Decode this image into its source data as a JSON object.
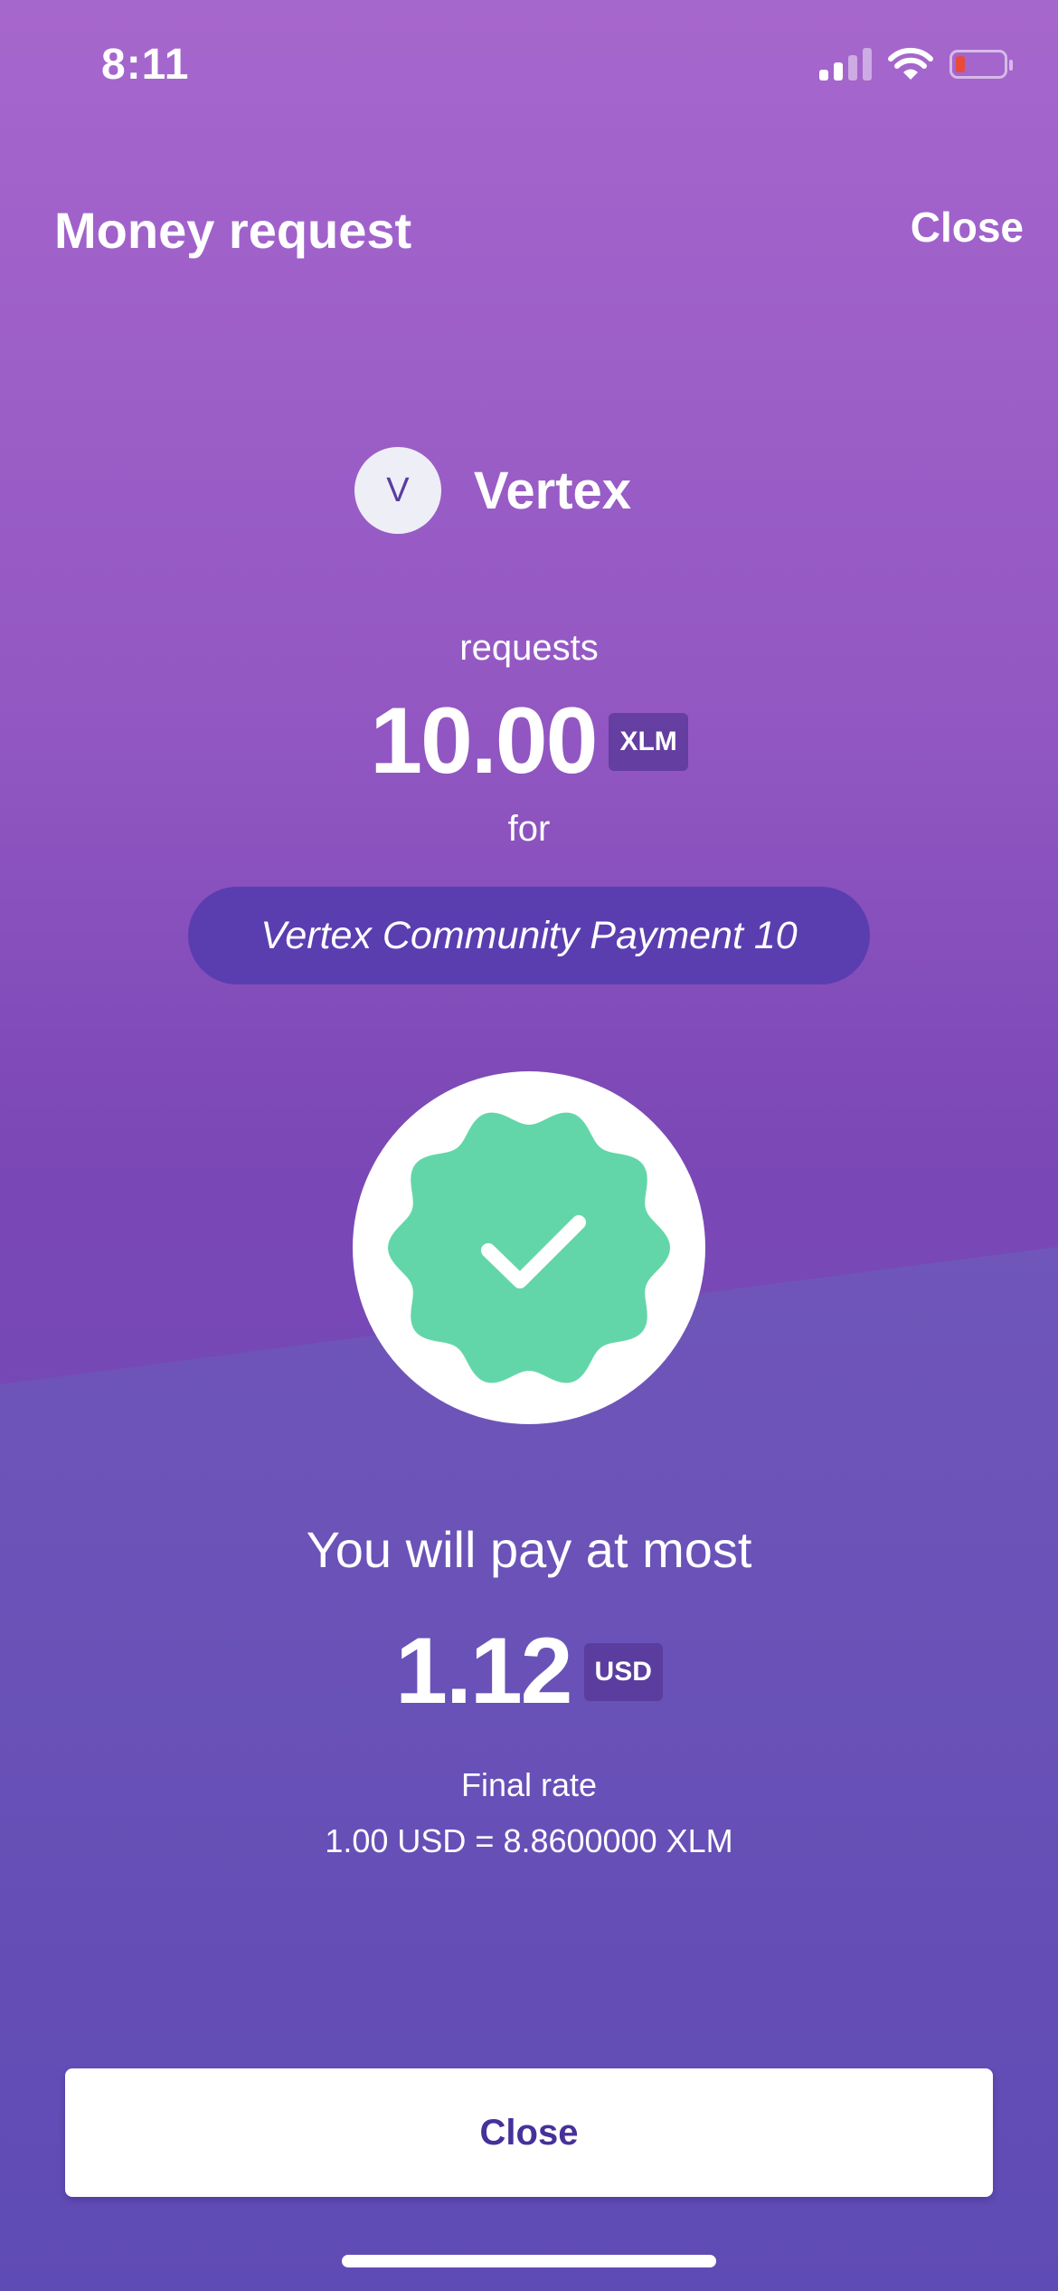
{
  "status_bar": {
    "time": "8:11",
    "signal_bars_active": 2,
    "signal_bars_total": 4,
    "battery_level_percent": 10,
    "icons": [
      "cellular-signal-icon",
      "wifi-icon",
      "battery-low-icon"
    ]
  },
  "header": {
    "title": "Money request",
    "close_label": "Close"
  },
  "requester": {
    "avatar_initial": "V",
    "name": "Vertex"
  },
  "request": {
    "requests_label": "requests",
    "amount": "10.00",
    "currency": "XLM",
    "for_label": "for",
    "memo": "Vertex Community Payment 10"
  },
  "status_badge": {
    "icon": "check-badge-icon",
    "color": "#63d6a9"
  },
  "payment": {
    "label": "You will pay at most",
    "amount": "1.12",
    "currency": "USD",
    "rate_label": "Final rate",
    "rate_value": "1.00 USD = 8.8600000 XLM"
  },
  "footer": {
    "close_label": "Close"
  },
  "colors": {
    "background_top": "#a667cd",
    "background_bottom": "#5f4bb5",
    "memo_pill": "#5a3eb0",
    "button_text": "#46319a",
    "battery_low": "#ea4a3c"
  }
}
